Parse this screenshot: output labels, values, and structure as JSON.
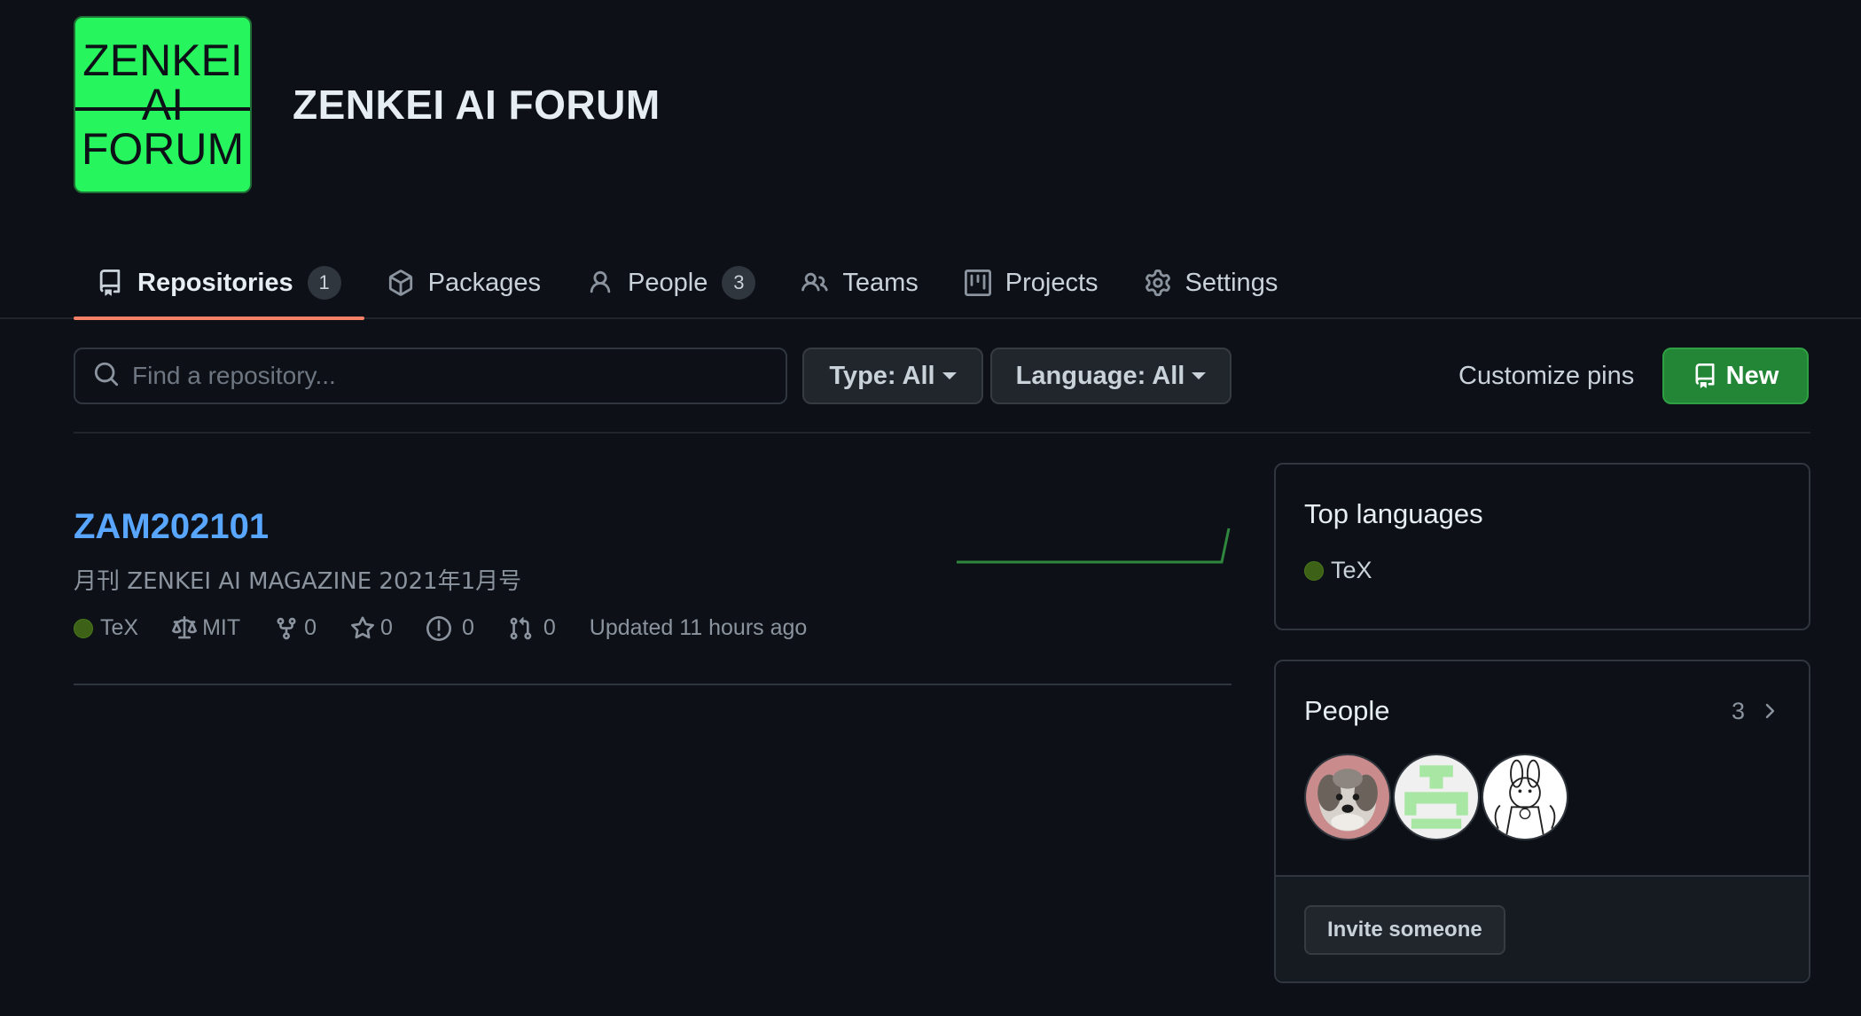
{
  "org": {
    "logo_lines": [
      "ZENKEI",
      "AI",
      "FORUM"
    ],
    "name": "ZENKEI AI FORUM"
  },
  "tabs": [
    {
      "label": "Repositories",
      "icon": "repo-icon",
      "counter": "1",
      "active": true
    },
    {
      "label": "Packages",
      "icon": "package-icon",
      "active": false
    },
    {
      "label": "People",
      "icon": "person-icon",
      "counter": "3",
      "active": false
    },
    {
      "label": "Teams",
      "icon": "people-icon",
      "active": false
    },
    {
      "label": "Projects",
      "icon": "project-icon",
      "active": false
    },
    {
      "label": "Settings",
      "icon": "gear-icon",
      "active": false
    }
  ],
  "filters": {
    "search_placeholder": "Find a repository...",
    "type_label": "Type: All",
    "language_label": "Language: All",
    "customize_label": "Customize pins",
    "new_label": "New"
  },
  "repo": {
    "name": "ZAM202101",
    "description": "月刊 ZENKEI AI MAGAZINE 2021年1月号",
    "language": "TeX",
    "license": "MIT",
    "forks": "0",
    "stars": "0",
    "issues": "0",
    "pulls": "0",
    "updated": "Updated 11 hours ago"
  },
  "sidebar": {
    "top_languages_title": "Top languages",
    "top_language": "TeX",
    "people_title": "People",
    "people_count": "3",
    "invite_label": "Invite someone"
  },
  "colors": {
    "background": "#0d1117",
    "accent_link": "#58a6ff",
    "active_tab_underline": "#f78166",
    "new_button": "#238636",
    "logo_green": "#27f55e",
    "tex_language": "#3d6117"
  }
}
